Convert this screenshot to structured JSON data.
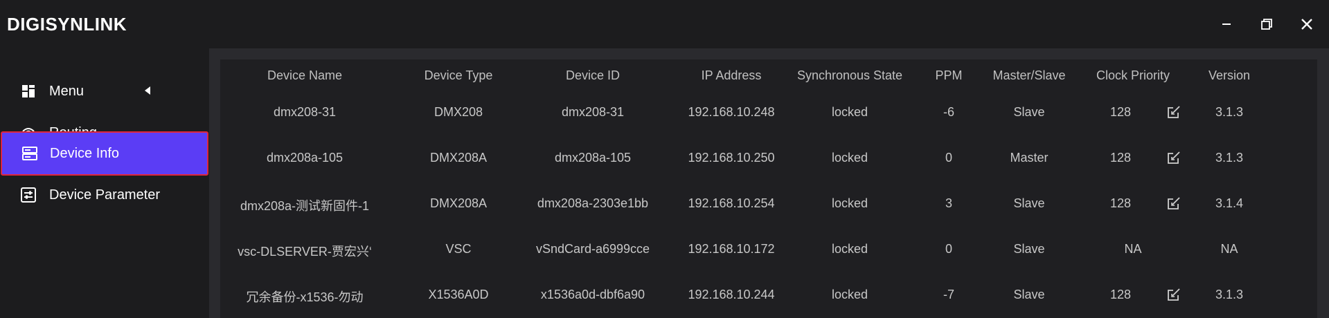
{
  "app": {
    "title": "DIGISYNLINK"
  },
  "window_controls": {
    "minimize_icon": "minimize-icon",
    "maximize_icon": "restore-icon",
    "close_icon": "close-icon"
  },
  "sidebar": {
    "items": [
      {
        "label": "Menu",
        "icon": "grid-icon"
      },
      {
        "label": "Routing",
        "icon": "wifi-router-icon"
      },
      {
        "label": "Device Info",
        "icon": "server-icon",
        "active": true
      },
      {
        "label": "Device Parameter",
        "icon": "sliders-icon"
      }
    ]
  },
  "table": {
    "headers": [
      "Device Name",
      "Device Type",
      "Device ID",
      "IP Address",
      "Synchronous State",
      "PPM",
      "Master/Slave",
      "Clock Priority",
      "Version"
    ],
    "rows": [
      {
        "name": "dmx208-31",
        "type": "DMX208",
        "id": "dmx208-31",
        "ip": "192.168.10.248",
        "state": "locked",
        "ppm": "-6",
        "role": "Slave",
        "priority": "128",
        "editable": true,
        "version": "3.1.3"
      },
      {
        "name": "dmx208a-105",
        "type": "DMX208A",
        "id": "dmx208a-105",
        "ip": "192.168.10.250",
        "state": "locked",
        "ppm": "0",
        "role": "Master",
        "priority": "128",
        "editable": true,
        "version": "3.1.3"
      },
      {
        "name": "dmx208a-测试新固件-1",
        "type": "DMX208A",
        "id": "dmx208a-2303e1bb",
        "ip": "192.168.10.254",
        "state": "locked",
        "ppm": "3",
        "role": "Slave",
        "priority": "128",
        "editable": true,
        "version": "3.1.4"
      },
      {
        "name": "vsc-DLSERVER-贾宏兴‘",
        "type": "VSC",
        "id": "vSndCard-a6999cce",
        "ip": "192.168.10.172",
        "state": "locked",
        "ppm": "0",
        "role": "Slave",
        "priority": "NA",
        "editable": false,
        "version": "NA"
      },
      {
        "name": "冗余备份-x1536-勿动",
        "type": "X1536A0D",
        "id": "x1536a0d-dbf6a90",
        "ip": "192.168.10.244",
        "state": "locked",
        "ppm": "-7",
        "role": "Slave",
        "priority": "128",
        "editable": true,
        "version": "3.1.3"
      }
    ]
  },
  "colors": {
    "background": "#1c1c1e",
    "active_nav": "#5b3df5",
    "active_border": "#e0263a",
    "table_bg": "#1f1f22"
  }
}
